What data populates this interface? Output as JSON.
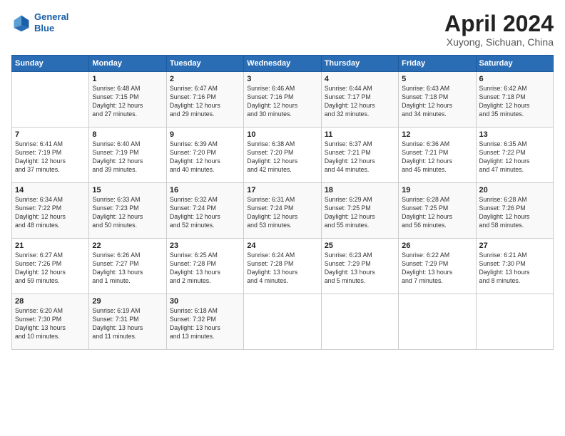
{
  "header": {
    "logo_line1": "General",
    "logo_line2": "Blue",
    "month": "April 2024",
    "location": "Xuyong, Sichuan, China"
  },
  "weekdays": [
    "Sunday",
    "Monday",
    "Tuesday",
    "Wednesday",
    "Thursday",
    "Friday",
    "Saturday"
  ],
  "weeks": [
    [
      {
        "num": "",
        "info": ""
      },
      {
        "num": "1",
        "info": "Sunrise: 6:48 AM\nSunset: 7:15 PM\nDaylight: 12 hours\nand 27 minutes."
      },
      {
        "num": "2",
        "info": "Sunrise: 6:47 AM\nSunset: 7:16 PM\nDaylight: 12 hours\nand 29 minutes."
      },
      {
        "num": "3",
        "info": "Sunrise: 6:46 AM\nSunset: 7:16 PM\nDaylight: 12 hours\nand 30 minutes."
      },
      {
        "num": "4",
        "info": "Sunrise: 6:44 AM\nSunset: 7:17 PM\nDaylight: 12 hours\nand 32 minutes."
      },
      {
        "num": "5",
        "info": "Sunrise: 6:43 AM\nSunset: 7:18 PM\nDaylight: 12 hours\nand 34 minutes."
      },
      {
        "num": "6",
        "info": "Sunrise: 6:42 AM\nSunset: 7:18 PM\nDaylight: 12 hours\nand 35 minutes."
      }
    ],
    [
      {
        "num": "7",
        "info": "Sunrise: 6:41 AM\nSunset: 7:19 PM\nDaylight: 12 hours\nand 37 minutes."
      },
      {
        "num": "8",
        "info": "Sunrise: 6:40 AM\nSunset: 7:19 PM\nDaylight: 12 hours\nand 39 minutes."
      },
      {
        "num": "9",
        "info": "Sunrise: 6:39 AM\nSunset: 7:20 PM\nDaylight: 12 hours\nand 40 minutes."
      },
      {
        "num": "10",
        "info": "Sunrise: 6:38 AM\nSunset: 7:20 PM\nDaylight: 12 hours\nand 42 minutes."
      },
      {
        "num": "11",
        "info": "Sunrise: 6:37 AM\nSunset: 7:21 PM\nDaylight: 12 hours\nand 44 minutes."
      },
      {
        "num": "12",
        "info": "Sunrise: 6:36 AM\nSunset: 7:21 PM\nDaylight: 12 hours\nand 45 minutes."
      },
      {
        "num": "13",
        "info": "Sunrise: 6:35 AM\nSunset: 7:22 PM\nDaylight: 12 hours\nand 47 minutes."
      }
    ],
    [
      {
        "num": "14",
        "info": "Sunrise: 6:34 AM\nSunset: 7:22 PM\nDaylight: 12 hours\nand 48 minutes."
      },
      {
        "num": "15",
        "info": "Sunrise: 6:33 AM\nSunset: 7:23 PM\nDaylight: 12 hours\nand 50 minutes."
      },
      {
        "num": "16",
        "info": "Sunrise: 6:32 AM\nSunset: 7:24 PM\nDaylight: 12 hours\nand 52 minutes."
      },
      {
        "num": "17",
        "info": "Sunrise: 6:31 AM\nSunset: 7:24 PM\nDaylight: 12 hours\nand 53 minutes."
      },
      {
        "num": "18",
        "info": "Sunrise: 6:29 AM\nSunset: 7:25 PM\nDaylight: 12 hours\nand 55 minutes."
      },
      {
        "num": "19",
        "info": "Sunrise: 6:28 AM\nSunset: 7:25 PM\nDaylight: 12 hours\nand 56 minutes."
      },
      {
        "num": "20",
        "info": "Sunrise: 6:28 AM\nSunset: 7:26 PM\nDaylight: 12 hours\nand 58 minutes."
      }
    ],
    [
      {
        "num": "21",
        "info": "Sunrise: 6:27 AM\nSunset: 7:26 PM\nDaylight: 12 hours\nand 59 minutes."
      },
      {
        "num": "22",
        "info": "Sunrise: 6:26 AM\nSunset: 7:27 PM\nDaylight: 13 hours\nand 1 minute."
      },
      {
        "num": "23",
        "info": "Sunrise: 6:25 AM\nSunset: 7:28 PM\nDaylight: 13 hours\nand 2 minutes."
      },
      {
        "num": "24",
        "info": "Sunrise: 6:24 AM\nSunset: 7:28 PM\nDaylight: 13 hours\nand 4 minutes."
      },
      {
        "num": "25",
        "info": "Sunrise: 6:23 AM\nSunset: 7:29 PM\nDaylight: 13 hours\nand 5 minutes."
      },
      {
        "num": "26",
        "info": "Sunrise: 6:22 AM\nSunset: 7:29 PM\nDaylight: 13 hours\nand 7 minutes."
      },
      {
        "num": "27",
        "info": "Sunrise: 6:21 AM\nSunset: 7:30 PM\nDaylight: 13 hours\nand 8 minutes."
      }
    ],
    [
      {
        "num": "28",
        "info": "Sunrise: 6:20 AM\nSunset: 7:30 PM\nDaylight: 13 hours\nand 10 minutes."
      },
      {
        "num": "29",
        "info": "Sunrise: 6:19 AM\nSunset: 7:31 PM\nDaylight: 13 hours\nand 11 minutes."
      },
      {
        "num": "30",
        "info": "Sunrise: 6:18 AM\nSunset: 7:32 PM\nDaylight: 13 hours\nand 13 minutes."
      },
      {
        "num": "",
        "info": ""
      },
      {
        "num": "",
        "info": ""
      },
      {
        "num": "",
        "info": ""
      },
      {
        "num": "",
        "info": ""
      }
    ]
  ]
}
